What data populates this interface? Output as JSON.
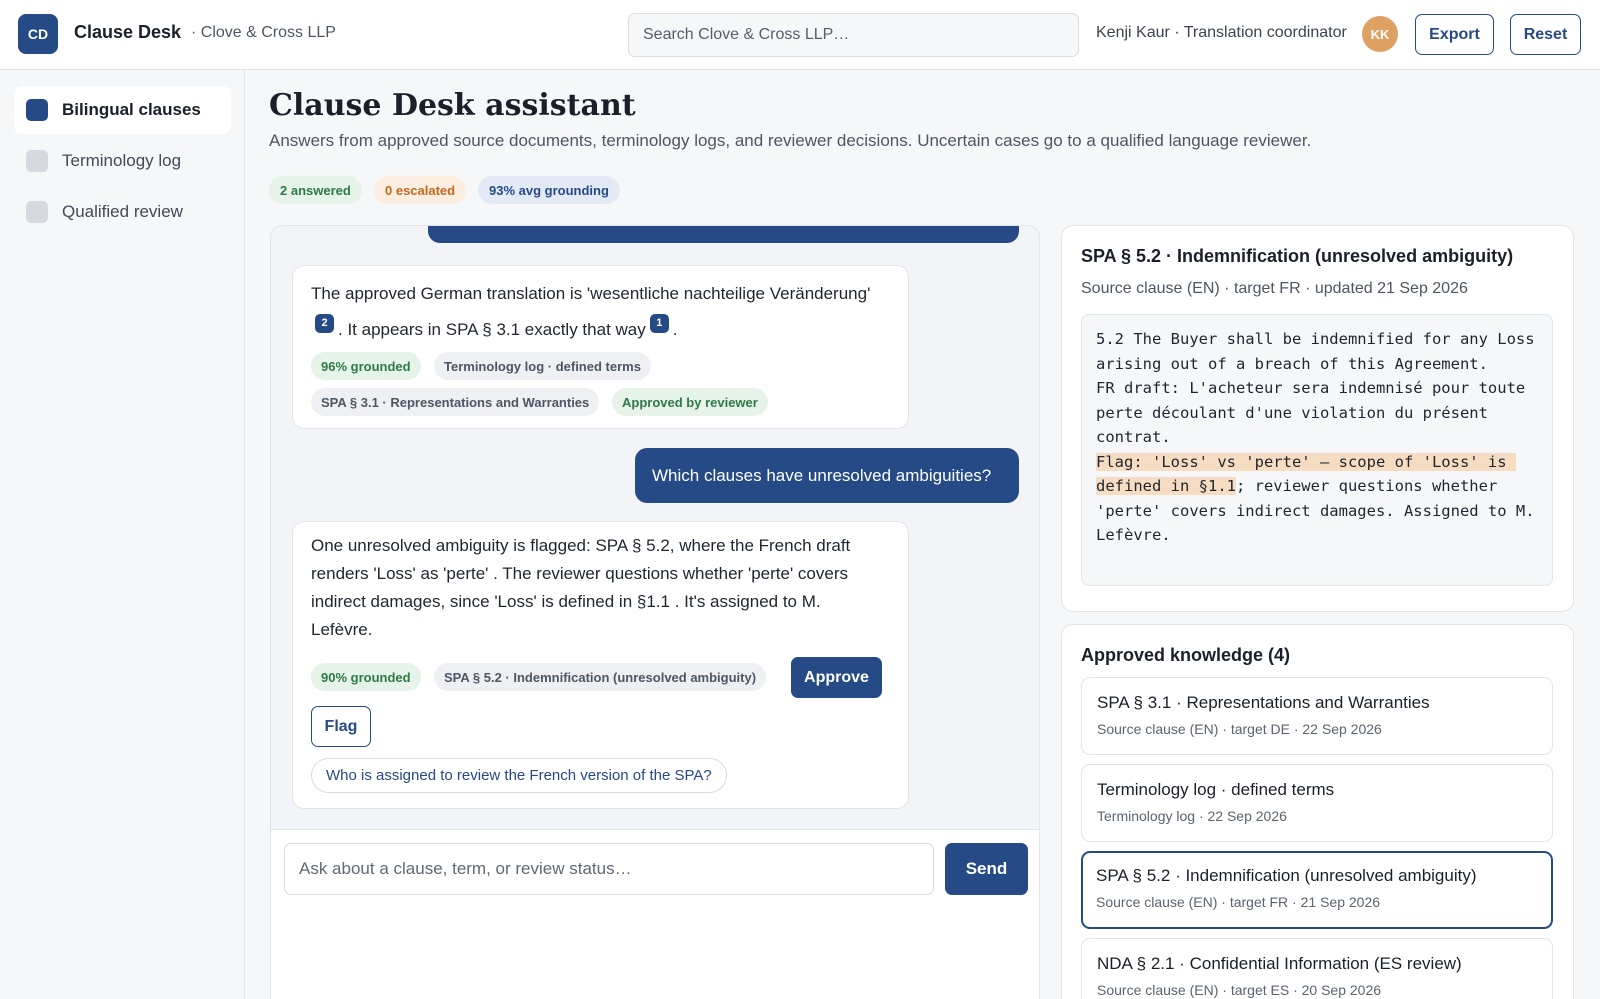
{
  "header": {
    "logo": "CD",
    "app_name": "Clause Desk",
    "org": "· Clove & Cross LLP",
    "search_placeholder": "Search Clove & Cross LLP…",
    "user": "Kenji Kaur · Translation coordinator",
    "avatar_initials": "KK",
    "export_label": "Export",
    "reset_label": "Reset"
  },
  "sidebar": {
    "items": [
      {
        "label": "Bilingual clauses",
        "active": true
      },
      {
        "label": "Terminology log",
        "active": false
      },
      {
        "label": "Qualified review",
        "active": false
      }
    ]
  },
  "main": {
    "title": "Clause Desk assistant",
    "subtitle": "Answers from approved source documents, terminology logs, and reviewer decisions. Uncertain cases go to a qualified language reviewer.",
    "stats": {
      "answered": "2 answered",
      "escalated": "0 escalated",
      "grounding": "93% avg grounding"
    }
  },
  "chat": {
    "answer1": {
      "text_part1": "The approved German translation is 'wesentliche nachteilige Veränderung'",
      "cite_a": "2",
      "text_part2": ". It appears in SPA § 3.1 exactly that way",
      "cite_b": "1",
      "text_part3": ".",
      "grounded": "96% grounded",
      "source1": "Terminology log · defined terms",
      "source2": "SPA § 3.1 · Representations and Warranties",
      "status": "Approved by reviewer"
    },
    "question2": "Which clauses have unresolved ambiguities?",
    "answer2": {
      "text": "One unresolved ambiguity is flagged: SPA § 5.2, where the French draft renders 'Loss' as 'perte' . The reviewer questions whether 'perte' covers indirect damages, since 'Loss' is defined in §1.1 . It's assigned to M. Lefèvre.",
      "grounded": "90% grounded",
      "source": "SPA § 5.2 · Indemnification (unresolved ambiguity)",
      "approve_label": "Approve",
      "flag_label": "Flag",
      "suggestion": "Who is assigned to review the French version of the SPA?"
    },
    "composer_placeholder": "Ask about a clause, term, or review status…",
    "send_label": "Send"
  },
  "detail": {
    "title": "SPA § 5.2 · Indemnification (unresolved ambiguity)",
    "meta": "Source clause (EN) · target FR · updated 21 Sep 2026",
    "body_before": "5.2 The Buyer shall be indemnified for any Loss arising out of a breach of this Agreement.\nFR draft: L'acheteur sera indemnisé pour toute perte découlant d'une violation du présent contrat.\n",
    "body_highlight": "Flag: 'Loss' vs 'perte' — scope of 'Loss' is defined in §1.1",
    "body_after": "; reviewer questions whether 'perte' covers indirect damages. Assigned to M. Lefèvre."
  },
  "knowledge": {
    "title": "Approved knowledge (4)",
    "items": [
      {
        "title": "SPA § 3.1 · Representations and Warranties",
        "meta": "Source clause (EN) · target DE · 22 Sep 2026"
      },
      {
        "title": "Terminology log · defined terms",
        "meta": "Terminology log · 22 Sep 2026"
      },
      {
        "title": "SPA § 5.2 · Indemnification (unresolved ambiguity)",
        "meta": "Source clause (EN) · target FR · 21 Sep 2026"
      },
      {
        "title": "NDA § 2.1 · Confidential Information (ES review)",
        "meta": "Source clause (EN) · target ES · 20 Sep 2026"
      }
    ]
  },
  "colors": {
    "accent": "#254a85",
    "success": "#2f7a45",
    "warning": "#c0691f",
    "highlight": "#f6dcc0"
  }
}
